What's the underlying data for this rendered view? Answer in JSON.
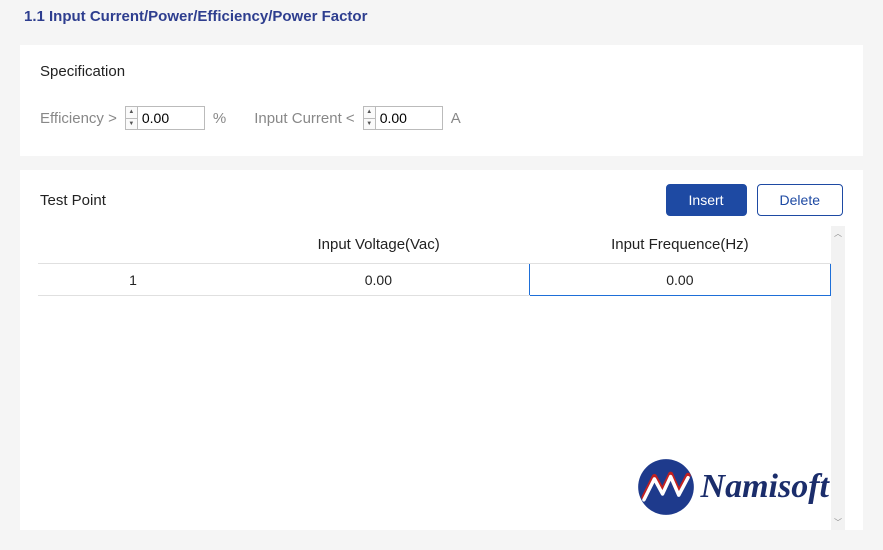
{
  "section": {
    "title": "1.1 Input Current/Power/Efficiency/Power Factor"
  },
  "spec": {
    "panel_title": "Specification",
    "efficiency_label": "Efficiency >",
    "efficiency_value": "0.00",
    "efficiency_unit": "%",
    "current_label": "Input Current <",
    "current_value": "0.00",
    "current_unit": "A"
  },
  "testpoint": {
    "title": "Test Point",
    "insert_btn": "Insert",
    "delete_btn": "Delete",
    "columns": {
      "c0": "",
      "c1": "Input Voltage(Vac)",
      "c2": "Input Frequence(Hz)"
    },
    "row1": {
      "idx": "1",
      "voltage": "0.00",
      "freq": "0.00"
    }
  },
  "logo": {
    "text": "Namisoft"
  }
}
